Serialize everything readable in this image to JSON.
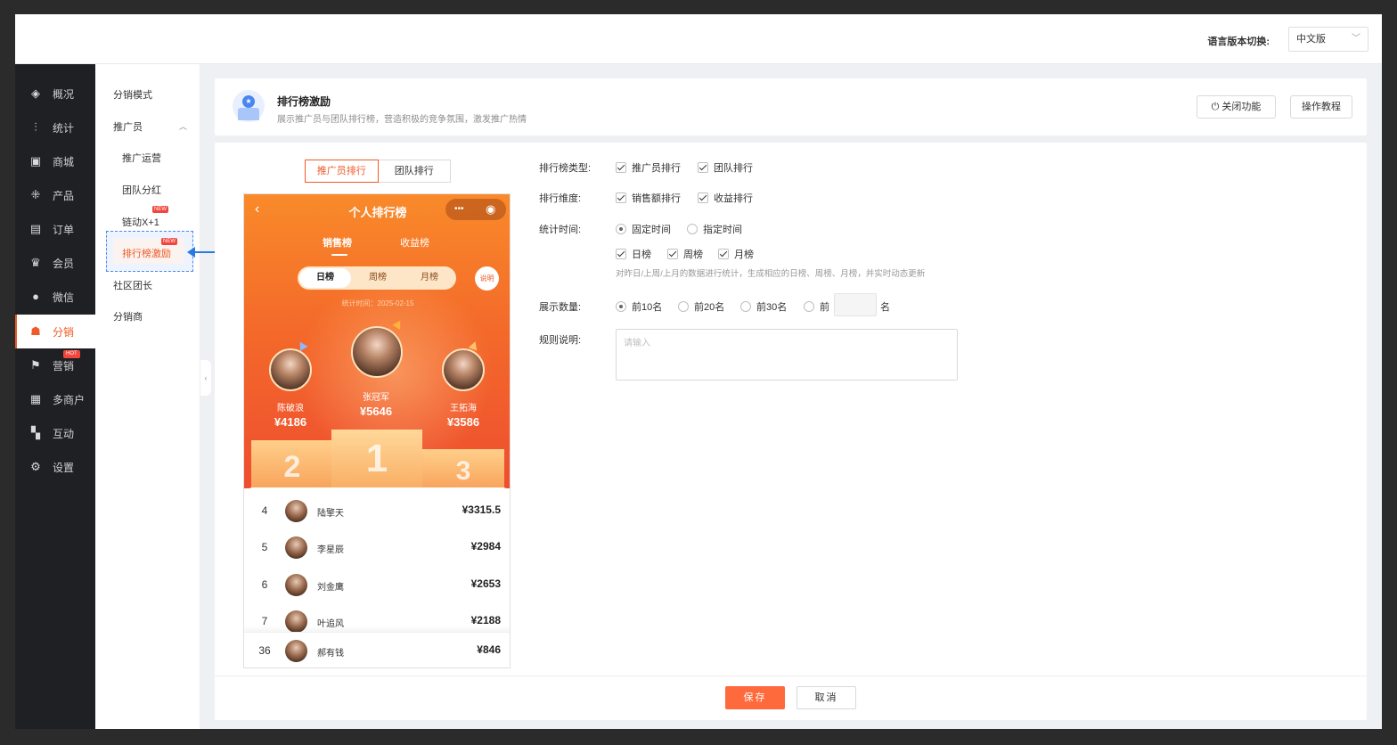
{
  "topbar": {
    "lang_label": "语言版本切换:",
    "lang_value": "中文版"
  },
  "sidebar": {
    "items": [
      {
        "label": "概况",
        "icon": "layers-icon"
      },
      {
        "label": "统计",
        "icon": "chart-icon"
      },
      {
        "label": "商城",
        "icon": "store-icon"
      },
      {
        "label": "产品",
        "icon": "grid-icon"
      },
      {
        "label": "订单",
        "icon": "order-icon"
      },
      {
        "label": "会员",
        "icon": "crown-icon"
      },
      {
        "label": "微信",
        "icon": "wechat-icon"
      },
      {
        "label": "分销",
        "icon": "users-icon",
        "active": true
      },
      {
        "label": "营销",
        "icon": "flag-icon",
        "badge": "HOT"
      },
      {
        "label": "多商户",
        "icon": "shop-icon"
      },
      {
        "label": "互动",
        "icon": "apps-icon"
      },
      {
        "label": "设置",
        "icon": "gear-icon"
      }
    ],
    "accent": "#f05a28"
  },
  "subnav": {
    "items": [
      "分销模式",
      "推广员",
      "推广运营",
      "团队分红",
      "链动X+1",
      "排行榜激励",
      "社区团长",
      "分销商"
    ],
    "new_badge": "NEW"
  },
  "header": {
    "title": "排行榜激励",
    "desc": "展示推广员与团队排行榜，营造积极的竞争氛围，激发推广热情",
    "close_btn": "关闭功能",
    "tutorial_btn": "操作教程"
  },
  "preview_tabs": [
    "推广员排行",
    "团队排行"
  ],
  "phone": {
    "title": "个人排行榜",
    "capsule_dots": "•••",
    "tabs": [
      "销售榜",
      "收益榜"
    ],
    "periods": [
      "日榜",
      "周榜",
      "月榜"
    ],
    "help": "说明",
    "stat_time": "统计时间：2025-02-15",
    "top3": [
      {
        "name": "张冠军",
        "amount": "¥5646"
      },
      {
        "name": "陈破浪",
        "amount": "¥4186"
      },
      {
        "name": "王拓海",
        "amount": "¥3586"
      }
    ],
    "podium": [
      "2",
      "1",
      "3"
    ],
    "list": [
      {
        "rank": "4",
        "name": "陆擎天",
        "amount": "¥3315.5"
      },
      {
        "rank": "5",
        "name": "李星辰",
        "amount": "¥2984"
      },
      {
        "rank": "6",
        "name": "刘金鹰",
        "amount": "¥2653"
      },
      {
        "rank": "7",
        "name": "叶追风",
        "amount": "¥2188"
      }
    ],
    "me": {
      "rank": "36",
      "name": "郝有钱",
      "amount": "¥846"
    }
  },
  "form": {
    "type_label": "排行榜类型:",
    "type_opts": [
      "推广员排行",
      "团队排行"
    ],
    "dim_label": "排行维度:",
    "dim_opts": [
      "销售额排行",
      "收益排行"
    ],
    "time_label": "统计时间:",
    "time_opts": [
      "固定时间",
      "指定时间"
    ],
    "period_opts": [
      "日榜",
      "周榜",
      "月榜"
    ],
    "hint": "对昨日/上周/上月的数据进行统计，生成相应的日榜、周榜、月榜，并实时动态更新",
    "count_label": "展示数量:",
    "count_opts": [
      "前10名",
      "前20名",
      "前30名",
      "前"
    ],
    "count_suffix": "名",
    "rule_label": "规则说明:",
    "rule_placeholder": "请输入"
  },
  "footer": {
    "save": "保存",
    "cancel": "取消"
  }
}
